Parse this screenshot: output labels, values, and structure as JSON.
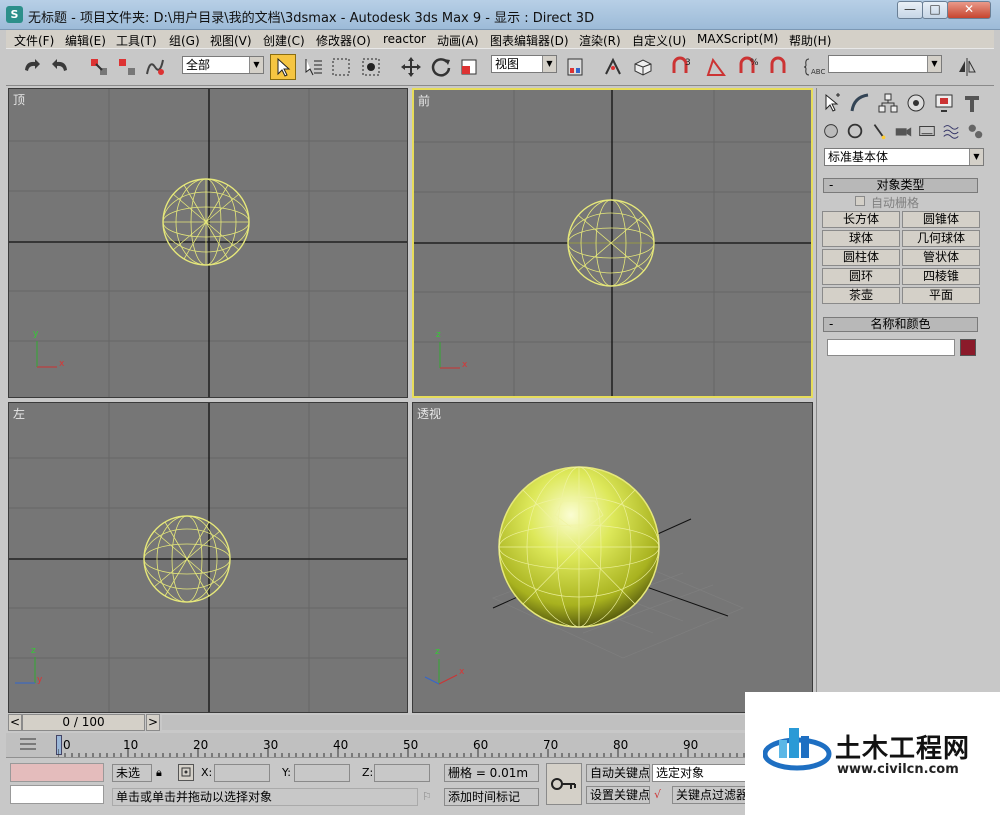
{
  "window": {
    "title": "无标题    - 项目文件夹: D:\\用户目录\\我的文档\\3dsmax     - Autodesk 3ds Max 9      - 显示 : Direct 3D",
    "app_icon": "3ds-max-icon",
    "min_label": "—",
    "max_label": "□",
    "close_label": "✕"
  },
  "menu": [
    "文件(F)",
    "编辑(E)",
    "工具(T)",
    "组(G)",
    "视图(V)",
    "创建(C)",
    "修改器(O)",
    "reactor",
    "动画(A)",
    "图表编辑器(D)",
    "渲染(R)",
    "自定义(U)",
    "MAXScript(M)",
    "帮助(H)"
  ],
  "toolbar": {
    "selection_filter": "全部",
    "ref_coord": "视图",
    "named_selection": ""
  },
  "viewports": {
    "top": "顶",
    "front": "前",
    "left": "左",
    "perspective": "透视",
    "axis_x": "x",
    "axis_y": "y",
    "axis_z": "z"
  },
  "command_panel": {
    "category": "标准基本体",
    "object_type_title": "对象类型",
    "auto_grid": "自动栅格",
    "buttons": [
      "长方体",
      "圆锥体",
      "球体",
      "几何球体",
      "圆柱体",
      "管状体",
      "圆环",
      "四棱锥",
      "茶壶",
      "平面"
    ],
    "name_color_title": "名称和颜色",
    "name_value": "",
    "object_color": "#8b1a2a",
    "rollout_minus": "-"
  },
  "time_slider": {
    "frame_display": "0 / 100",
    "prev": "<",
    "next": ">"
  },
  "trackbar": {
    "ticks": [
      "0",
      "10",
      "20",
      "30",
      "40",
      "50",
      "60",
      "70",
      "80",
      "90"
    ]
  },
  "status": {
    "selection": "未选",
    "x_label": "X:",
    "y_label": "Y:",
    "z_label": "Z:",
    "grid": "栅格 = 0.01m",
    "auto_key": "自动关键点",
    "set_key": "设置关键点",
    "selected_object": "选定对象",
    "key_filter": "关键点过滤器",
    "prompt": "单击或单击并拖动以选择对象",
    "add_time_tag": "添加时间标记"
  },
  "watermark": {
    "name": "土木工程网",
    "url": "www.civilcn.com"
  },
  "colors": {
    "accent": "#e7dd5a",
    "viewport": "#767676",
    "wireframe": "#e6e87a"
  }
}
